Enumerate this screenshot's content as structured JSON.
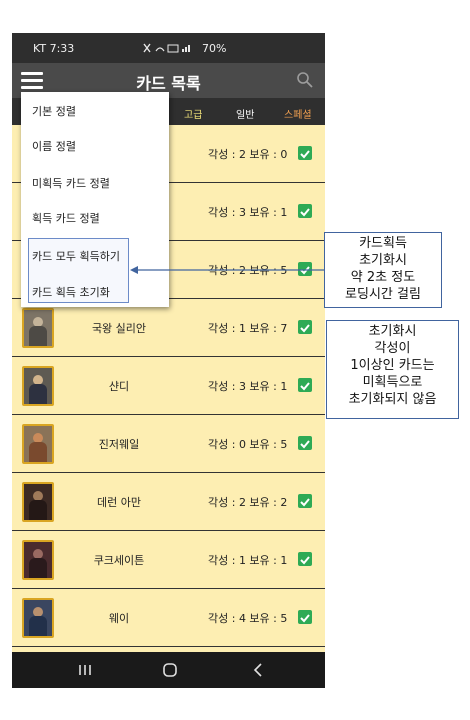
{
  "status_bar": {
    "carrier_time": "KT 7:33",
    "battery": "70%"
  },
  "app_bar": {
    "title": "카드 목록"
  },
  "tabs": [
    {
      "label": "고급"
    },
    {
      "label": "일반"
    },
    {
      "label": "스페셜"
    }
  ],
  "dropdown": {
    "items": [
      {
        "label": "기본 정렬"
      },
      {
        "label": "이름 정렬"
      },
      {
        "label": "미획득 카드 정렬"
      },
      {
        "label": "획득 카드 정렬"
      },
      {
        "label": "카드 모두 획득하기"
      },
      {
        "label": "카드 획득 초기화"
      }
    ]
  },
  "cards": [
    {
      "name": "",
      "stat": "각성 : 2  보유 : 0"
    },
    {
      "name": "",
      "stat": "각성 : 3  보유 : 1"
    },
    {
      "name": "",
      "stat": "각성 : 2  보유 : 5"
    },
    {
      "name": "국왕 실리안",
      "stat": "각성 : 1  보유 : 7"
    },
    {
      "name": "샨디",
      "stat": "각성 : 3  보유 : 1"
    },
    {
      "name": "진저웨일",
      "stat": "각성 : 0  보유 : 5"
    },
    {
      "name": "데런 아만",
      "stat": "각성 : 2  보유 : 2"
    },
    {
      "name": "쿠크세이튼",
      "stat": "각성 : 1  보유 : 1"
    },
    {
      "name": "웨이",
      "stat": "각성 : 4  보유 : 5"
    }
  ],
  "annotations": {
    "callout_1": [
      "카드획득",
      "초기화시",
      "약 2초 정도",
      "로딩시간 걸림"
    ],
    "callout_2": [
      "초기화시",
      "각성이",
      "1이상인 카드는",
      "미획득으로",
      "초기화되지 않음"
    ]
  },
  "colors": {
    "list_background": "#fdeeb2",
    "check_green": "#2eaa55",
    "frame_gold": "#d9a522",
    "callout_border": "#41649e"
  }
}
